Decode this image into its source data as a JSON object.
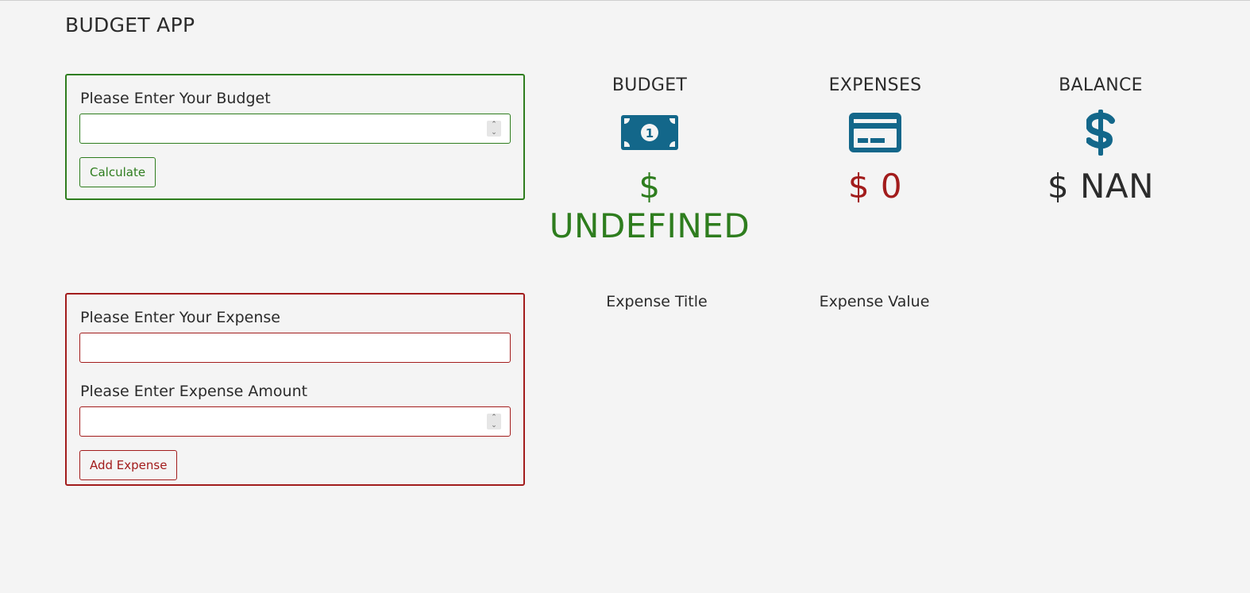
{
  "app": {
    "title": "BUDGET APP"
  },
  "colors": {
    "budget_accent": "#2e7d1e",
    "expense_accent": "#a21c1c",
    "icon_color": "#13678a",
    "text": "#2b2b2b",
    "background": "#f4f4f4"
  },
  "budget_form": {
    "label": "Please Enter Your Budget",
    "input_value": "",
    "button_label": "Calculate"
  },
  "expense_form": {
    "title_label": "Please Enter Your Expense",
    "title_value": "",
    "amount_label": "Please Enter Expense Amount",
    "amount_value": "",
    "button_label": "Add Expense"
  },
  "stats": {
    "budget": {
      "title": "BUDGET",
      "icon": "money-bill-icon",
      "value": "$ UNDEFINED"
    },
    "expenses": {
      "title": "EXPENSES",
      "icon": "credit-card-icon",
      "value": "$ 0"
    },
    "balance": {
      "title": "BALANCE",
      "icon": "dollar-sign-icon",
      "value": "$ NAN"
    }
  },
  "expense_list": {
    "columns": [
      "Expense Title",
      "Expense Value"
    ],
    "rows": []
  }
}
